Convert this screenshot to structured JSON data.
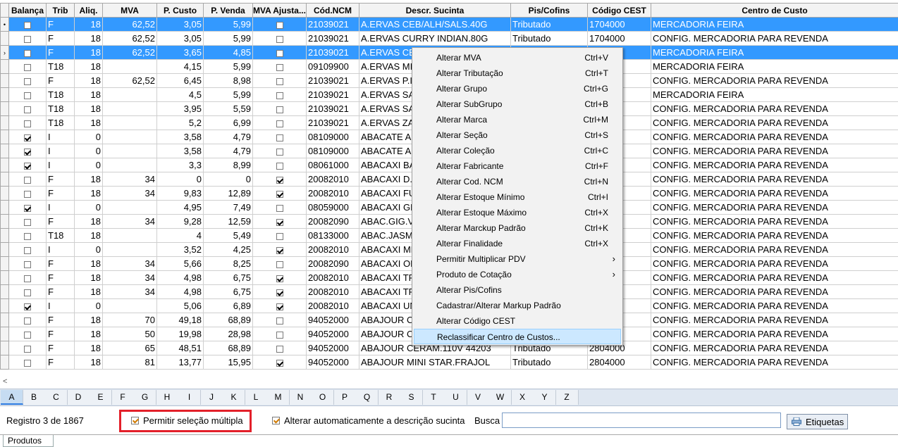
{
  "grid": {
    "columns": [
      "Balança",
      "Trib",
      "Aliq.",
      "MVA",
      "P. Custo",
      "P. Venda",
      "MVA Ajusta...",
      "Cód.NCM",
      "Descr. Sucinta",
      "Pis/Cofins",
      "Código CEST",
      "Centro de Custo"
    ],
    "rows": [
      {
        "ind": "•",
        "bal": false,
        "trib": "F",
        "aliq": "18",
        "mva": "62,52",
        "custo": "3,05",
        "venda": "5,99",
        "mvaaj": false,
        "ncm": "21039021",
        "desc": "A.ERVAS CEB/ALH/SALS.40G",
        "pis": "Tributado",
        "cest": "1704000",
        "cc": "MERCADORIA FEIRA",
        "sel": true
      },
      {
        "ind": "",
        "bal": false,
        "trib": "F",
        "aliq": "18",
        "mva": "62,52",
        "custo": "3,05",
        "venda": "5,99",
        "mvaaj": false,
        "ncm": "21039021",
        "desc": "A.ERVAS CURRY INDIAN.80G",
        "pis": "Tributado",
        "cest": "1704000",
        "cc": "CONFIG. MERCADORIA PARA REVENDA",
        "sel": false
      },
      {
        "ind": "›",
        "bal": false,
        "trib": "F",
        "aliq": "18",
        "mva": "62,52",
        "custo": "3,65",
        "venda": "4,85",
        "mvaaj": false,
        "ncm": "21039021",
        "desc": "A.ERVAS CE",
        "pis": "",
        "cest": "",
        "cc": "MERCADORIA FEIRA",
        "sel": true
      },
      {
        "ind": "",
        "bal": false,
        "trib": "T18",
        "aliq": "18",
        "mva": "",
        "custo": "4,15",
        "venda": "5,99",
        "mvaaj": false,
        "ncm": "09109900",
        "desc": "A.ERVAS MI",
        "pis": "",
        "cest": "",
        "cc": "MERCADORIA FEIRA",
        "sel": false
      },
      {
        "ind": "",
        "bal": false,
        "trib": "F",
        "aliq": "18",
        "mva": "62,52",
        "custo": "6,45",
        "venda": "8,98",
        "mvaaj": false,
        "ncm": "21039021",
        "desc": "A.ERVAS P.I",
        "pis": "",
        "cest": "",
        "cc": "CONFIG. MERCADORIA PARA REVENDA",
        "sel": false
      },
      {
        "ind": "",
        "bal": false,
        "trib": "T18",
        "aliq": "18",
        "mva": "",
        "custo": "4,5",
        "venda": "5,99",
        "mvaaj": false,
        "ncm": "21039021",
        "desc": "A.ERVAS SA",
        "pis": "",
        "cest": "",
        "cc": "MERCADORIA FEIRA",
        "sel": false
      },
      {
        "ind": "",
        "bal": false,
        "trib": "T18",
        "aliq": "18",
        "mva": "",
        "custo": "3,95",
        "venda": "5,59",
        "mvaaj": false,
        "ncm": "21039021",
        "desc": "A.ERVAS SA",
        "pis": "",
        "cest": "",
        "cc": "CONFIG. MERCADORIA PARA REVENDA",
        "sel": false
      },
      {
        "ind": "",
        "bal": false,
        "trib": "T18",
        "aliq": "18",
        "mva": "",
        "custo": "5,2",
        "venda": "6,99",
        "mvaaj": false,
        "ncm": "21039021",
        "desc": "A.ERVAS ZA",
        "pis": "",
        "cest": "",
        "cc": "CONFIG. MERCADORIA PARA REVENDA",
        "sel": false
      },
      {
        "ind": "",
        "bal": true,
        "trib": "I",
        "aliq": "0",
        "mva": "",
        "custo": "3,58",
        "venda": "4,79",
        "mvaaj": false,
        "ncm": "08109000",
        "desc": "ABACATE A",
        "pis": "",
        "cest": "",
        "cc": "CONFIG. MERCADORIA PARA REVENDA",
        "sel": false
      },
      {
        "ind": "",
        "bal": true,
        "trib": "I",
        "aliq": "0",
        "mva": "",
        "custo": "3,58",
        "venda": "4,79",
        "mvaaj": false,
        "ncm": "08109000",
        "desc": "ABACATE A",
        "pis": "",
        "cest": "",
        "cc": "CONFIG. MERCADORIA PARA REVENDA",
        "sel": false
      },
      {
        "ind": "",
        "bal": true,
        "trib": "I",
        "aliq": "0",
        "mva": "",
        "custo": "3,3",
        "venda": "8,99",
        "mvaaj": false,
        "ncm": "08061000",
        "desc": "ABACAXI BA",
        "pis": "",
        "cest": "",
        "cc": "CONFIG. MERCADORIA PARA REVENDA",
        "sel": false
      },
      {
        "ind": "",
        "bal": false,
        "trib": "F",
        "aliq": "18",
        "mva": "34",
        "custo": "0",
        "venda": "0",
        "mvaaj": true,
        "ncm": "20082010",
        "desc": "ABACAXI D.I",
        "pis": "",
        "cest": "",
        "cc": "CONFIG. MERCADORIA PARA REVENDA",
        "sel": false
      },
      {
        "ind": "",
        "bal": false,
        "trib": "F",
        "aliq": "18",
        "mva": "34",
        "custo": "9,83",
        "venda": "12,89",
        "mvaaj": true,
        "ncm": "20082010",
        "desc": "ABACAXI FU",
        "pis": "",
        "cest": "",
        "cc": "CONFIG. MERCADORIA PARA REVENDA",
        "sel": false
      },
      {
        "ind": "",
        "bal": true,
        "trib": "I",
        "aliq": "0",
        "mva": "",
        "custo": "4,95",
        "venda": "7,49",
        "mvaaj": false,
        "ncm": "08059000",
        "desc": "ABACAXI GD",
        "pis": "",
        "cest": "",
        "cc": "CONFIG. MERCADORIA PARA REVENDA",
        "sel": false
      },
      {
        "ind": "",
        "bal": false,
        "trib": "F",
        "aliq": "18",
        "mva": "34",
        "custo": "9,28",
        "venda": "12,59",
        "mvaaj": true,
        "ncm": "20082090",
        "desc": "ABAC.GIG.V",
        "pis": "",
        "cest": "",
        "cc": "CONFIG. MERCADORIA PARA REVENDA",
        "sel": false
      },
      {
        "ind": "",
        "bal": false,
        "trib": "T18",
        "aliq": "18",
        "mva": "",
        "custo": "4",
        "venda": "5,49",
        "mvaaj": false,
        "ncm": "08133000",
        "desc": "ABAC.JASM",
        "pis": "",
        "cest": "",
        "cc": "CONFIG. MERCADORIA PARA REVENDA",
        "sel": false
      },
      {
        "ind": "",
        "bal": false,
        "trib": "I",
        "aliq": "0",
        "mva": "",
        "custo": "3,52",
        "venda": "4,25",
        "mvaaj": true,
        "ncm": "20082010",
        "desc": "ABACAXI ME",
        "pis": "",
        "cest": "",
        "cc": "CONFIG. MERCADORIA PARA REVENDA",
        "sel": false
      },
      {
        "ind": "",
        "bal": false,
        "trib": "F",
        "aliq": "18",
        "mva": "34",
        "custo": "5,66",
        "venda": "8,25",
        "mvaaj": false,
        "ncm": "20082090",
        "desc": "ABACAXI OL",
        "pis": "",
        "cest": "",
        "cc": "CONFIG. MERCADORIA PARA REVENDA",
        "sel": false
      },
      {
        "ind": "",
        "bal": false,
        "trib": "F",
        "aliq": "18",
        "mva": "34",
        "custo": "4,98",
        "venda": "6,75",
        "mvaaj": true,
        "ncm": "20082010",
        "desc": "ABACAXI TR",
        "pis": "",
        "cest": "",
        "cc": "CONFIG. MERCADORIA PARA REVENDA",
        "sel": false
      },
      {
        "ind": "",
        "bal": false,
        "trib": "F",
        "aliq": "18",
        "mva": "34",
        "custo": "4,98",
        "venda": "6,75",
        "mvaaj": true,
        "ncm": "20082010",
        "desc": "ABACAXI TR",
        "pis": "",
        "cest": "",
        "cc": "CONFIG. MERCADORIA PARA REVENDA",
        "sel": false
      },
      {
        "ind": "",
        "bal": true,
        "trib": "I",
        "aliq": "0",
        "mva": "",
        "custo": "5,06",
        "venda": "6,89",
        "mvaaj": true,
        "ncm": "20082010",
        "desc": "ABACAXI UN",
        "pis": "",
        "cest": "",
        "cc": "CONFIG. MERCADORIA PARA REVENDA",
        "sel": false
      },
      {
        "ind": "",
        "bal": false,
        "trib": "F",
        "aliq": "18",
        "mva": "70",
        "custo": "49,18",
        "venda": "68,89",
        "mvaaj": false,
        "ncm": "94052000",
        "desc": "ABAJOUR C",
        "pis": "",
        "cest": "",
        "cc": "CONFIG. MERCADORIA PARA REVENDA",
        "sel": false
      },
      {
        "ind": "",
        "bal": false,
        "trib": "F",
        "aliq": "18",
        "mva": "50",
        "custo": "19,98",
        "venda": "28,98",
        "mvaaj": false,
        "ncm": "94052000",
        "desc": "ABAJOUR C",
        "pis": "",
        "cest": "",
        "cc": "CONFIG. MERCADORIA PARA REVENDA",
        "sel": false
      },
      {
        "ind": "",
        "bal": false,
        "trib": "F",
        "aliq": "18",
        "mva": "65",
        "custo": "48,51",
        "venda": "68,89",
        "mvaaj": false,
        "ncm": "94052000",
        "desc": "ABAJOUR CERAM.110V 44203",
        "pis": "Tributado",
        "cest": "2804000",
        "cc": "CONFIG. MERCADORIA PARA REVENDA",
        "sel": false
      },
      {
        "ind": "",
        "bal": false,
        "trib": "F",
        "aliq": "18",
        "mva": "81",
        "custo": "13,77",
        "venda": "15,95",
        "mvaaj": true,
        "ncm": "94052000",
        "desc": "ABAJOUR MINI STAR.FRAJOL",
        "pis": "Tributado",
        "cest": "2804000",
        "cc": "CONFIG. MERCADORIA PARA REVENDA",
        "sel": false
      }
    ]
  },
  "context_menu": {
    "items": [
      {
        "label": "Alterar MVA",
        "shortcut": "Ctrl+V"
      },
      {
        "label": "Alterar Tributação",
        "shortcut": "Ctrl+T"
      },
      {
        "label": "Alterar Grupo",
        "shortcut": "Ctrl+G"
      },
      {
        "label": "Alterar SubGrupo",
        "shortcut": "Ctrl+B"
      },
      {
        "label": "Alterar Marca",
        "shortcut": "Ctrl+M"
      },
      {
        "label": "Alterar Seção",
        "shortcut": "Ctrl+S"
      },
      {
        "label": "Alterar Coleção",
        "shortcut": "Ctrl+C"
      },
      {
        "label": "Alterar Fabricante",
        "shortcut": "Ctrl+F"
      },
      {
        "label": "Alterar Cod. NCM",
        "shortcut": "Ctrl+N"
      },
      {
        "label": "Alterar Estoque Mínimo",
        "shortcut": "Ctrl+I"
      },
      {
        "label": "Alterar Estoque Máximo",
        "shortcut": "Ctrl+X"
      },
      {
        "label": "Alterar Marckup Padrão",
        "shortcut": "Ctrl+K"
      },
      {
        "label": "Alterar Finalidade",
        "shortcut": "Ctrl+X"
      },
      {
        "label": "Permitir Multiplicar PDV",
        "shortcut": "",
        "submenu": true
      },
      {
        "label": "Produto de Cotação",
        "shortcut": "",
        "submenu": true
      },
      {
        "label": "Alterar Pis/Cofins",
        "shortcut": ""
      },
      {
        "label": "Cadastrar/Alterar Markup Padrão",
        "shortcut": ""
      },
      {
        "label": "Alterar Código CEST",
        "shortcut": ""
      },
      {
        "label": "Reclassificar Centro de Custos...",
        "shortcut": "",
        "highlighted": true
      }
    ]
  },
  "scroll_arrow": "<",
  "alphabet": [
    "A",
    "B",
    "C",
    "D",
    "E",
    "F",
    "G",
    "H",
    "I",
    "J",
    "K",
    "L",
    "M",
    "N",
    "O",
    "P",
    "Q",
    "R",
    "S",
    "T",
    "U",
    "V",
    "W",
    "X",
    "Y",
    "Z"
  ],
  "alphabet_active": "A",
  "status": {
    "registro": "Registro 3 de 1867",
    "multi_select_label": "Permitir seleção múltipla",
    "multi_select_checked": true,
    "auto_desc_label": "Alterar automaticamente a descrição sucinta",
    "auto_desc_checked": true,
    "search_label": "Busca",
    "search_value": "",
    "etiquetas_label": "Etiquetas"
  },
  "tabs": [
    "Produtos"
  ],
  "colors": {
    "selection": "#3399ff",
    "highlight_box": "#e3202a"
  }
}
